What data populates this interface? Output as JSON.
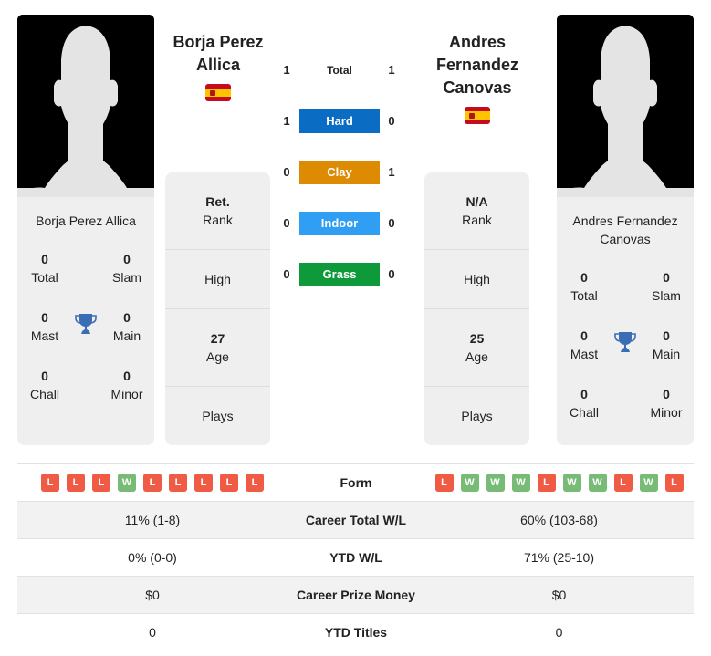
{
  "player1": {
    "name": "Borja Perez Allica",
    "name_lines": [
      "Borja Perez",
      "Allica"
    ],
    "country_flag": "spain-flag",
    "titles": {
      "total": {
        "value": "0",
        "label": "Total"
      },
      "slam": {
        "value": "0",
        "label": "Slam"
      },
      "mast": {
        "value": "0",
        "label": "Mast"
      },
      "main": {
        "value": "0",
        "label": "Main"
      },
      "chall": {
        "value": "0",
        "label": "Chall"
      },
      "minor": {
        "value": "0",
        "label": "Minor"
      }
    },
    "info": {
      "rank": {
        "value": "Ret.",
        "label": "Rank"
      },
      "high": {
        "value": "",
        "label": "High"
      },
      "age": {
        "value": "27",
        "label": "Age"
      },
      "plays": {
        "value": "",
        "label": "Plays"
      }
    },
    "form": [
      "L",
      "L",
      "L",
      "W",
      "L",
      "L",
      "L",
      "L",
      "L"
    ]
  },
  "player2": {
    "name": "Andres Fernandez Canovas",
    "name_lines": [
      "Andres",
      "Fernandez",
      "Canovas"
    ],
    "card_name_lines": [
      "Andres Fernandez",
      "Canovas"
    ],
    "country_flag": "spain-flag",
    "titles": {
      "total": {
        "value": "0",
        "label": "Total"
      },
      "slam": {
        "value": "0",
        "label": "Slam"
      },
      "mast": {
        "value": "0",
        "label": "Mast"
      },
      "main": {
        "value": "0",
        "label": "Main"
      },
      "chall": {
        "value": "0",
        "label": "Chall"
      },
      "minor": {
        "value": "0",
        "label": "Minor"
      }
    },
    "info": {
      "rank": {
        "value": "N/A",
        "label": "Rank"
      },
      "high": {
        "value": "",
        "label": "High"
      },
      "age": {
        "value": "25",
        "label": "Age"
      },
      "plays": {
        "value": "",
        "label": "Plays"
      }
    },
    "form": [
      "L",
      "W",
      "W",
      "W",
      "L",
      "W",
      "W",
      "L",
      "W",
      "L"
    ]
  },
  "h2h": [
    {
      "label": "Total",
      "p1": "1",
      "p2": "1",
      "color": ""
    },
    {
      "label": "Hard",
      "p1": "1",
      "p2": "0",
      "color": "#0a6cc2"
    },
    {
      "label": "Clay",
      "p1": "0",
      "p2": "1",
      "color": "#de8b04"
    },
    {
      "label": "Indoor",
      "p1": "0",
      "p2": "0",
      "color": "#2f9ef3"
    },
    {
      "label": "Grass",
      "p1": "0",
      "p2": "0",
      "color": "#0e9a3b"
    }
  ],
  "stats": {
    "form_label": "Form",
    "rows": [
      {
        "label": "Career Total W/L",
        "p1": "11% (1-8)",
        "p2": "60% (103-68)"
      },
      {
        "label": "YTD W/L",
        "p1": "0% (0-0)",
        "p2": "71% (25-10)"
      },
      {
        "label": "Career Prize Money",
        "p1": "$0",
        "p2": "$0"
      },
      {
        "label": "YTD Titles",
        "p1": "0",
        "p2": "0"
      }
    ]
  },
  "colors": {
    "loss": "#ef5b44",
    "win": "#77bb77",
    "trophy": "#3a6db5"
  }
}
